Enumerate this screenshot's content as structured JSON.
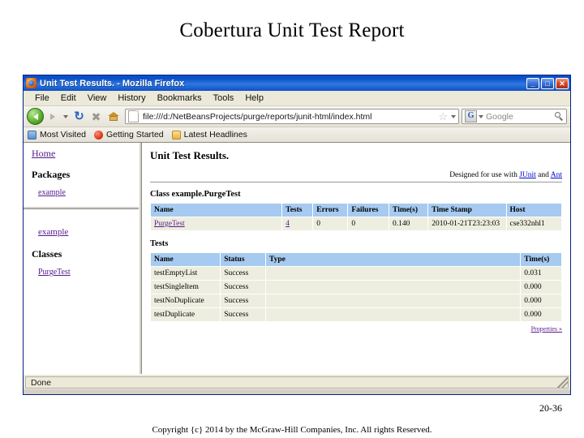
{
  "slide": {
    "title": "Cobertura Unit Test Report",
    "page_number": "20-36",
    "copyright": "Copyright {c} 2014 by the McGraw-Hill Companies, Inc. All rights Reserved."
  },
  "browser": {
    "window_title": "Unit Test Results. - Mozilla Firefox",
    "window_buttons": {
      "minimize": "_",
      "maximize": "□",
      "close": "✕"
    },
    "menu": [
      "File",
      "Edit",
      "View",
      "History",
      "Bookmarks",
      "Tools",
      "Help"
    ],
    "toolbar": {
      "url": "file:///d:/NetBeansProjects/purge/reports/junit-html/index.html",
      "search_placeholder": "Google",
      "search_engine_letter": "G"
    },
    "bookmarks": [
      {
        "label": "Most Visited",
        "icon": "most-visited"
      },
      {
        "label": "Getting Started",
        "icon": "getting-started"
      },
      {
        "label": "Latest Headlines",
        "icon": "latest-headlines"
      }
    ],
    "status": "Done"
  },
  "sidebar": {
    "home_label": "Home",
    "packages_heading": "Packages",
    "package_link": "example",
    "current_package": "example",
    "classes_heading": "Classes",
    "class_link": "PurgeTest"
  },
  "report": {
    "title": "Unit Test Results.",
    "designed_prefix": "Designed for use with ",
    "designed_link1": "JUnit",
    "designed_mid": " and ",
    "designed_link2": "Ant",
    "class_heading": "Class example.PurgeTest",
    "summary_headers": [
      "Name",
      "Tests",
      "Errors",
      "Failures",
      "Time(s)",
      "Time Stamp",
      "Host"
    ],
    "summary_row": {
      "name": "PurgeTest",
      "tests": "4",
      "errors": "0",
      "failures": "0",
      "time": "0.140",
      "timestamp": "2010-01-21T23:23:03",
      "host": "cse332nhl1"
    },
    "tests_heading": "Tests",
    "tests_headers": [
      "Name",
      "Status",
      "Type",
      "Time(s)"
    ],
    "tests_rows": [
      {
        "name": "testEmptyList",
        "status": "Success",
        "type": "",
        "time": "0.031"
      },
      {
        "name": "testSingleItem",
        "status": "Success",
        "type": "",
        "time": "0.000"
      },
      {
        "name": "testNoDuplicate",
        "status": "Success",
        "type": "",
        "time": "0.000"
      },
      {
        "name": "testDuplicate",
        "status": "Success",
        "type": "",
        "time": "0.000"
      }
    ],
    "properties_link": "Properties »"
  },
  "colors": {
    "table_header": "#a6caf0",
    "table_row": "#eeeee0",
    "link": "#551a8b",
    "titlebar": "#0a50c8"
  }
}
